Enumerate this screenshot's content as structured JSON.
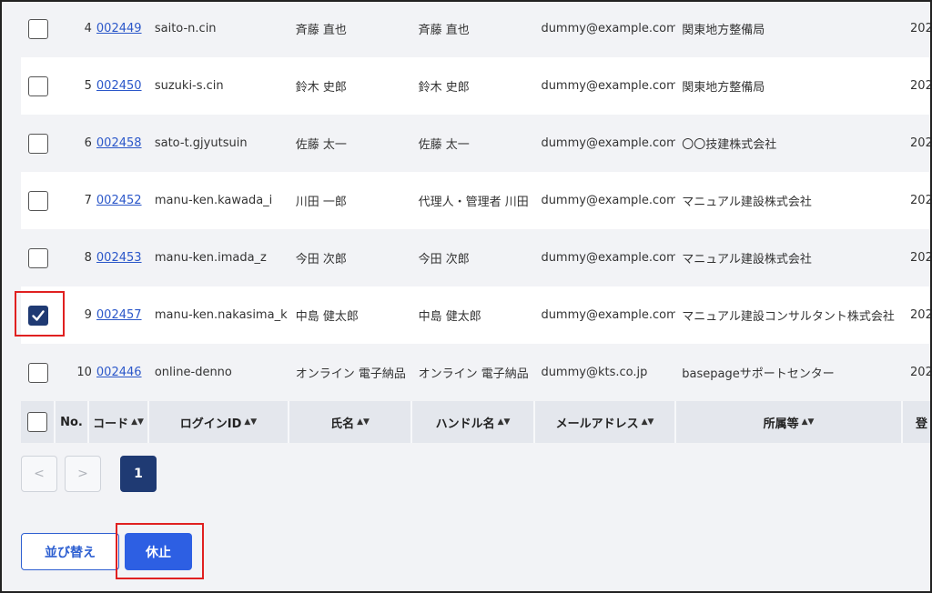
{
  "rows": [
    {
      "no": "4",
      "code": "002449",
      "login": "saito-n.cin",
      "name": "斉藤 直也",
      "handle": "斉藤 直也",
      "mail": "dummy@example.com",
      "org": "関東地方整備局",
      "reg": "202",
      "checked": false
    },
    {
      "no": "5",
      "code": "002450",
      "login": "suzuki-s.cin",
      "name": "鈴木 史郎",
      "handle": "鈴木 史郎",
      "mail": "dummy@example.com",
      "org": "関東地方整備局",
      "reg": "202",
      "checked": false
    },
    {
      "no": "6",
      "code": "002458",
      "login": "sato-t.gjyutsuin",
      "name": "佐藤 太一",
      "handle": "佐藤 太一",
      "mail": "dummy@example.com",
      "org": "〇〇技建株式会社",
      "reg": "202",
      "checked": false
    },
    {
      "no": "7",
      "code": "002452",
      "login": "manu-ken.kawada_i",
      "name": "川田 一郎",
      "handle": "代理人・管理者 川田",
      "mail": "dummy@example.com",
      "org": "マニュアル建設株式会社",
      "reg": "202",
      "checked": false
    },
    {
      "no": "8",
      "code": "002453",
      "login": "manu-ken.imada_z",
      "name": "今田 次郎",
      "handle": "今田 次郎",
      "mail": "dummy@example.com",
      "org": "マニュアル建設株式会社",
      "reg": "202",
      "checked": false
    },
    {
      "no": "9",
      "code": "002457",
      "login": "manu-ken.nakasima_k",
      "name": "中島 健太郎",
      "handle": "中島 健太郎",
      "mail": "dummy@example.com",
      "org": "マニュアル建設コンサルタント株式会社",
      "reg": "202",
      "checked": true
    },
    {
      "no": "10",
      "code": "002446",
      "login": "online-denno",
      "name": "オンライン 電子納品",
      "handle": "オンライン 電子納品",
      "mail": "dummy@kts.co.jp",
      "org": "basepageサポートセンター",
      "reg": "202",
      "checked": false
    }
  ],
  "header": {
    "no": "No.",
    "code": "コード",
    "login": "ログインID",
    "name": "氏名",
    "handle": "ハンドル名",
    "mail": "メールアドレス",
    "org": "所属等",
    "reg": "登",
    "sort_icon": "sort-icon"
  },
  "pager": {
    "prev": "<",
    "next": ">",
    "current": "1"
  },
  "actions": {
    "sort_label": "並び替え",
    "suspend_label": "休止"
  },
  "colors": {
    "link": "#2b57c9",
    "primary": "#2d5fe3",
    "navy": "#1f3a73",
    "highlight": "#e02020"
  }
}
